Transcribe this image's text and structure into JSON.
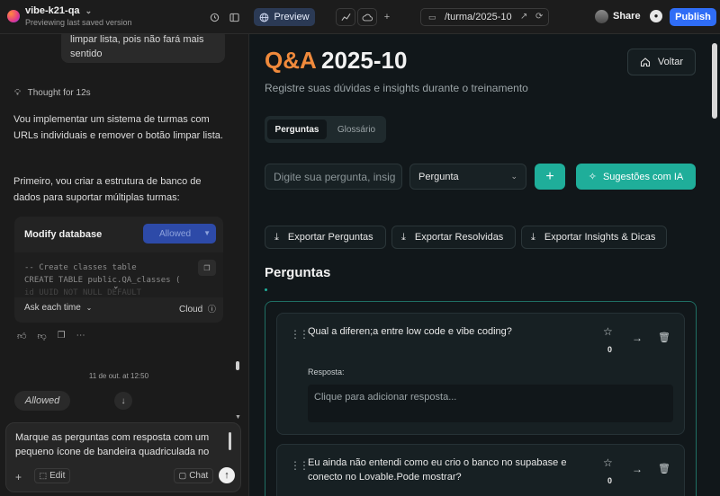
{
  "topbar": {
    "project_name": "vibe-k21-qa",
    "project_name_chevron": "⌄",
    "project_status": "Previewing last saved version",
    "preview_label": "Preview",
    "url_path": "/turma/2025-10",
    "share_label": "Share",
    "publish_label": "Publish"
  },
  "chat": {
    "user_message_partial": "limpar lista, pois não fará mais sentido",
    "thought_label": "Thought for 12s",
    "paragraph1": "Vou implementar um sistema de turmas com URLs individuais e remover o botão limpar lista.",
    "paragraph2": "Primeiro, vou criar a estrutura de banco de dados para suportar múltiplas turmas:",
    "tool_card": {
      "title": "Modify database",
      "status_button": "Allowed",
      "code_line1": "-- Create classes table",
      "code_line2": "CREATE TABLE public.QA_classes (",
      "code_line3": "  id UUID NOT NULL DEFAULT",
      "ask_label": "Ask each time",
      "cloud_label": "Cloud"
    },
    "timestamp": "11 de out. at 12:50",
    "allowed_pill": "Allowed",
    "composer_text": "Marque as perguntas com resposta com um pequeno ícone de bandeira quadriculada no",
    "edit_label": "Edit",
    "chat_label": "Chat"
  },
  "preview": {
    "title_accent": "Q&A",
    "title_main": "2025-10",
    "subtitle": "Registre suas dúvidas e insights durante o treinamento",
    "back_label": "Voltar",
    "tabs": [
      {
        "label": "Perguntas",
        "active": true
      },
      {
        "label": "Glossário",
        "active": false
      }
    ],
    "question_placeholder": "Digite sua pergunta, insig",
    "type_select_value": "Pergunta",
    "ai_button_label": "Sugestões com IA",
    "export_buttons": [
      {
        "label": "Exportar Perguntas"
      },
      {
        "label": "Exportar Resolvidas"
      },
      {
        "label": "Exportar Insights & Dicas"
      }
    ],
    "section_title": "Perguntas",
    "questions": [
      {
        "text": "Qual a diferen;a entre low code e vibe coding?",
        "stars": "0",
        "response_label": "Resposta:",
        "response_placeholder": "Clique para adicionar resposta..."
      },
      {
        "text": "Eu ainda não entendi como eu crio o banco no supabase e conecto no Lovable.Pode mostrar?",
        "stars": "0"
      }
    ]
  },
  "colors": {
    "accent_orange": "#f08a3c",
    "teal": "#1fae9a",
    "publish_blue": "#2f6df6"
  }
}
